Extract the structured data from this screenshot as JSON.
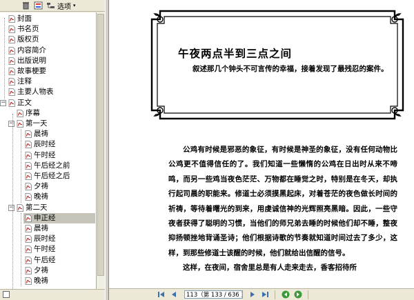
{
  "toolbar": {
    "options_label": "选项",
    "arrow": "▾"
  },
  "tree": {
    "items": [
      {
        "label": "封面",
        "level": 0,
        "expander": ""
      },
      {
        "label": "书名页",
        "level": 0,
        "expander": ""
      },
      {
        "label": "版权页",
        "level": 0,
        "expander": ""
      },
      {
        "label": "内容简介",
        "level": 0,
        "expander": ""
      },
      {
        "label": "出版说明",
        "level": 0,
        "expander": ""
      },
      {
        "label": "故事梗要",
        "level": 0,
        "expander": ""
      },
      {
        "label": "注释",
        "level": 0,
        "expander": ""
      },
      {
        "label": "主要人物表",
        "level": 0,
        "expander": ""
      },
      {
        "label": "正文",
        "level": 0,
        "expander": "−"
      },
      {
        "label": "序幕",
        "level": 1,
        "expander": ""
      },
      {
        "label": "第一天",
        "level": 1,
        "expander": "−"
      },
      {
        "label": "晨祷",
        "level": 2,
        "expander": ""
      },
      {
        "label": "辰时经",
        "level": 2,
        "expander": ""
      },
      {
        "label": "午时经",
        "level": 2,
        "expander": ""
      },
      {
        "label": "午后经之前",
        "level": 2,
        "expander": ""
      },
      {
        "label": "午后经之后",
        "level": 2,
        "expander": ""
      },
      {
        "label": "夕祷",
        "level": 2,
        "expander": ""
      },
      {
        "label": "晚祷",
        "level": 2,
        "expander": ""
      },
      {
        "label": "第二天",
        "level": 1,
        "expander": "−"
      },
      {
        "label": "申正经",
        "level": 2,
        "expander": "",
        "selected": true
      },
      {
        "label": "晨祷",
        "level": 2,
        "expander": ""
      },
      {
        "label": "辰时经",
        "level": 2,
        "expander": ""
      },
      {
        "label": "午时经",
        "level": 2,
        "expander": ""
      },
      {
        "label": "午后经",
        "level": 2,
        "expander": ""
      },
      {
        "label": "夕祷",
        "level": 2,
        "expander": ""
      },
      {
        "label": "晚祷",
        "level": 2,
        "expander": ""
      }
    ]
  },
  "document": {
    "chapter_title": "午夜两点半到三点之间",
    "chapter_summary": "叙述那几个钟头不可言传的幸福，接着发现了最残忍的案件。",
    "paragraphs": [
      "公鸡有时候是邪恶的象征，有时候是神圣的象征，没有任何动物比公鸡更不值得信任的了。我们知道一些懒惰的公鸡在日出时从来不啼鸣，而另一些鸡当夜色茫茫、万物都在睡觉之时，特别是在冬天，却执行起司晨的职能来。修道士必须摸黑起床，对着苍茫的夜色做长时间的祈祷，等待着曙光的到来，用虔诚信神的光辉照亮黑暗。因此，一些守夜者获得了聪明的习惯，当他们的师兄弟去睡的时候他们却不睡，整夜抑扬顿挫地背诵圣诗；他们根据诗歌的节奏就知道时间过去了多少，这样，到那些修道士该醒的时候，他们就给出信醒的信号。",
      "这样，在夜间，宿舍里总是有人走来走去，香客招待所"
    ]
  },
  "nav": {
    "page_input": "113（第 133 / 636 页）"
  }
}
